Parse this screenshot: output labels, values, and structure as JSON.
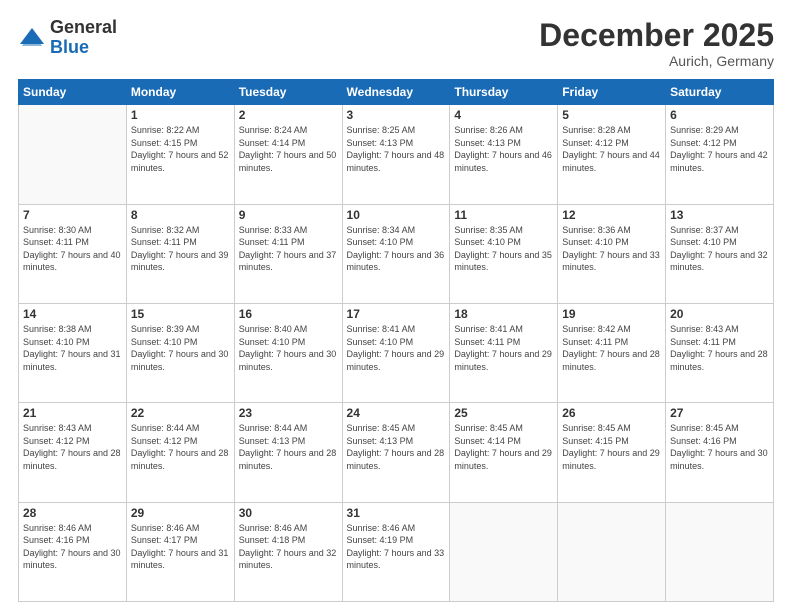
{
  "logo": {
    "general": "General",
    "blue": "Blue"
  },
  "title": "December 2025",
  "subtitle": "Aurich, Germany",
  "days_header": [
    "Sunday",
    "Monday",
    "Tuesday",
    "Wednesday",
    "Thursday",
    "Friday",
    "Saturday"
  ],
  "weeks": [
    [
      {
        "day": "",
        "sunrise": "",
        "sunset": "",
        "daylight": "",
        "empty": true
      },
      {
        "day": "1",
        "sunrise": "Sunrise: 8:22 AM",
        "sunset": "Sunset: 4:15 PM",
        "daylight": "Daylight: 7 hours and 52 minutes."
      },
      {
        "day": "2",
        "sunrise": "Sunrise: 8:24 AM",
        "sunset": "Sunset: 4:14 PM",
        "daylight": "Daylight: 7 hours and 50 minutes."
      },
      {
        "day": "3",
        "sunrise": "Sunrise: 8:25 AM",
        "sunset": "Sunset: 4:13 PM",
        "daylight": "Daylight: 7 hours and 48 minutes."
      },
      {
        "day": "4",
        "sunrise": "Sunrise: 8:26 AM",
        "sunset": "Sunset: 4:13 PM",
        "daylight": "Daylight: 7 hours and 46 minutes."
      },
      {
        "day": "5",
        "sunrise": "Sunrise: 8:28 AM",
        "sunset": "Sunset: 4:12 PM",
        "daylight": "Daylight: 7 hours and 44 minutes."
      },
      {
        "day": "6",
        "sunrise": "Sunrise: 8:29 AM",
        "sunset": "Sunset: 4:12 PM",
        "daylight": "Daylight: 7 hours and 42 minutes."
      }
    ],
    [
      {
        "day": "7",
        "sunrise": "Sunrise: 8:30 AM",
        "sunset": "Sunset: 4:11 PM",
        "daylight": "Daylight: 7 hours and 40 minutes."
      },
      {
        "day": "8",
        "sunrise": "Sunrise: 8:32 AM",
        "sunset": "Sunset: 4:11 PM",
        "daylight": "Daylight: 7 hours and 39 minutes."
      },
      {
        "day": "9",
        "sunrise": "Sunrise: 8:33 AM",
        "sunset": "Sunset: 4:11 PM",
        "daylight": "Daylight: 7 hours and 37 minutes."
      },
      {
        "day": "10",
        "sunrise": "Sunrise: 8:34 AM",
        "sunset": "Sunset: 4:10 PM",
        "daylight": "Daylight: 7 hours and 36 minutes."
      },
      {
        "day": "11",
        "sunrise": "Sunrise: 8:35 AM",
        "sunset": "Sunset: 4:10 PM",
        "daylight": "Daylight: 7 hours and 35 minutes."
      },
      {
        "day": "12",
        "sunrise": "Sunrise: 8:36 AM",
        "sunset": "Sunset: 4:10 PM",
        "daylight": "Daylight: 7 hours and 33 minutes."
      },
      {
        "day": "13",
        "sunrise": "Sunrise: 8:37 AM",
        "sunset": "Sunset: 4:10 PM",
        "daylight": "Daylight: 7 hours and 32 minutes."
      }
    ],
    [
      {
        "day": "14",
        "sunrise": "Sunrise: 8:38 AM",
        "sunset": "Sunset: 4:10 PM",
        "daylight": "Daylight: 7 hours and 31 minutes."
      },
      {
        "day": "15",
        "sunrise": "Sunrise: 8:39 AM",
        "sunset": "Sunset: 4:10 PM",
        "daylight": "Daylight: 7 hours and 30 minutes."
      },
      {
        "day": "16",
        "sunrise": "Sunrise: 8:40 AM",
        "sunset": "Sunset: 4:10 PM",
        "daylight": "Daylight: 7 hours and 30 minutes."
      },
      {
        "day": "17",
        "sunrise": "Sunrise: 8:41 AM",
        "sunset": "Sunset: 4:10 PM",
        "daylight": "Daylight: 7 hours and 29 minutes."
      },
      {
        "day": "18",
        "sunrise": "Sunrise: 8:41 AM",
        "sunset": "Sunset: 4:11 PM",
        "daylight": "Daylight: 7 hours and 29 minutes."
      },
      {
        "day": "19",
        "sunrise": "Sunrise: 8:42 AM",
        "sunset": "Sunset: 4:11 PM",
        "daylight": "Daylight: 7 hours and 28 minutes."
      },
      {
        "day": "20",
        "sunrise": "Sunrise: 8:43 AM",
        "sunset": "Sunset: 4:11 PM",
        "daylight": "Daylight: 7 hours and 28 minutes."
      }
    ],
    [
      {
        "day": "21",
        "sunrise": "Sunrise: 8:43 AM",
        "sunset": "Sunset: 4:12 PM",
        "daylight": "Daylight: 7 hours and 28 minutes."
      },
      {
        "day": "22",
        "sunrise": "Sunrise: 8:44 AM",
        "sunset": "Sunset: 4:12 PM",
        "daylight": "Daylight: 7 hours and 28 minutes."
      },
      {
        "day": "23",
        "sunrise": "Sunrise: 8:44 AM",
        "sunset": "Sunset: 4:13 PM",
        "daylight": "Daylight: 7 hours and 28 minutes."
      },
      {
        "day": "24",
        "sunrise": "Sunrise: 8:45 AM",
        "sunset": "Sunset: 4:13 PM",
        "daylight": "Daylight: 7 hours and 28 minutes."
      },
      {
        "day": "25",
        "sunrise": "Sunrise: 8:45 AM",
        "sunset": "Sunset: 4:14 PM",
        "daylight": "Daylight: 7 hours and 29 minutes."
      },
      {
        "day": "26",
        "sunrise": "Sunrise: 8:45 AM",
        "sunset": "Sunset: 4:15 PM",
        "daylight": "Daylight: 7 hours and 29 minutes."
      },
      {
        "day": "27",
        "sunrise": "Sunrise: 8:45 AM",
        "sunset": "Sunset: 4:16 PM",
        "daylight": "Daylight: 7 hours and 30 minutes."
      }
    ],
    [
      {
        "day": "28",
        "sunrise": "Sunrise: 8:46 AM",
        "sunset": "Sunset: 4:16 PM",
        "daylight": "Daylight: 7 hours and 30 minutes."
      },
      {
        "day": "29",
        "sunrise": "Sunrise: 8:46 AM",
        "sunset": "Sunset: 4:17 PM",
        "daylight": "Daylight: 7 hours and 31 minutes."
      },
      {
        "day": "30",
        "sunrise": "Sunrise: 8:46 AM",
        "sunset": "Sunset: 4:18 PM",
        "daylight": "Daylight: 7 hours and 32 minutes."
      },
      {
        "day": "31",
        "sunrise": "Sunrise: 8:46 AM",
        "sunset": "Sunset: 4:19 PM",
        "daylight": "Daylight: 7 hours and 33 minutes."
      },
      {
        "day": "",
        "sunrise": "",
        "sunset": "",
        "daylight": "",
        "empty": true
      },
      {
        "day": "",
        "sunrise": "",
        "sunset": "",
        "daylight": "",
        "empty": true
      },
      {
        "day": "",
        "sunrise": "",
        "sunset": "",
        "daylight": "",
        "empty": true
      }
    ]
  ]
}
